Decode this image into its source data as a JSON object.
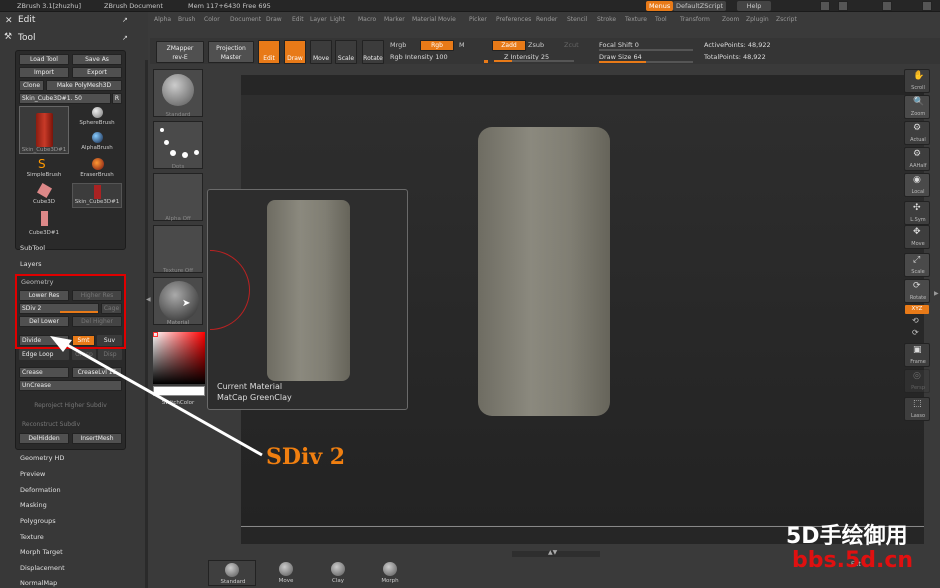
{
  "titlebar": {
    "app": "ZBrush 3.1[zhuzhu]",
    "doc": "ZBrush Document",
    "mem": "Mem 117+6430 Free 695",
    "menus": "Menus",
    "script": "DefaultZScript",
    "help": "Help"
  },
  "menubar": [
    "Alpha",
    "Brush",
    "Color",
    "Document",
    "Draw",
    "Edit",
    "Layer",
    "Light",
    "Macro",
    "Marker",
    "Material",
    "Movie",
    "Picker",
    "Preferences",
    "Render",
    "Stencil",
    "Stroke",
    "Texture",
    "Tool",
    "Transform",
    "Zoom",
    "Zplugin",
    "Zscript"
  ],
  "left": {
    "edit": "Edit",
    "tool": "Tool",
    "load_tool": "Load Tool",
    "save_as": "Save As",
    "import": "Import",
    "export": "Export",
    "clone": "Clone",
    "make_polymesh": "Make PolyMesh3D",
    "tool_name": "Skin_Cube3D#1. 50",
    "r": "R",
    "thumbs": [
      "Skin_Cube3D#1",
      "SphereBrush",
      "AlphaBrush",
      "SimpleBrush",
      "EraserBrush",
      "Cube3D",
      "Skin_Cube3D#1",
      "Cube3D#1"
    ],
    "subtool": "SubTool",
    "layers": "Layers",
    "geometry": "Geometry",
    "lower_res": "Lower Res",
    "higher_res": "Higher Res",
    "sdiv": "SDiv 2",
    "cage": "Cage",
    "del_lower": "Del Lower",
    "del_higher": "Del Higher",
    "divide": "Divide",
    "smt": "Smt",
    "suv": "Suv",
    "edge_loop": "Edge Loop",
    "grasp": "Grasp",
    "disp": "Disp",
    "crease": "Crease",
    "crease_lvl": "CreaseLvl 15",
    "uncrease": "UnCrease",
    "reproject": "Reproject Higher Subdiv",
    "reconstruct": "Reconstruct Subdiv",
    "delhidden": "DelHidden",
    "insertmesh": "InsertMesh",
    "cats": [
      "Geometry HD",
      "Preview",
      "Deformation",
      "Masking",
      "Polygroups",
      "Texture",
      "Morph Target",
      "Displacement",
      "NormalMap"
    ]
  },
  "top": {
    "zmapper": "ZMapper",
    "rev": "rev-E",
    "projection": "Projection",
    "master": "Master",
    "edit": "Edit",
    "draw": "Draw",
    "move": "Move",
    "scale": "Scale",
    "rotate": "Rotate",
    "mrgb": "Mrgb",
    "rgb": "Rgb",
    "m": "M",
    "rgb_int": "Rgb Intensity 100",
    "zadd": "Zadd",
    "zsub": "Zsub",
    "zcut": "Zcut",
    "z_int": "Z Intensity 25",
    "focal": "Focal Shift 0",
    "draw_size": "Draw Size 64",
    "active": "ActivePoints: 48,922",
    "total": "TotalPoints: 48,922"
  },
  "shelf": [
    "Standard",
    "Dots",
    "Alpha Off",
    "Texture Off",
    "Material"
  ],
  "switch": "SwitchColor",
  "right": [
    "Scroll",
    "Zoom",
    "Actual",
    "AAHalf",
    "Local",
    "L.Sym",
    "Move",
    "Scale",
    "Rotate",
    "Frame",
    "Persp",
    "Lasso"
  ],
  "xyz": "XYZ",
  "popup": {
    "l1": "Current Material",
    "l2": "MatCap GreenClay"
  },
  "annotation": "SDiv 2",
  "bottom": [
    "Standard",
    "Move",
    "Clay",
    "Morph"
  ],
  "watermark": {
    "l1": "5D手绘御用",
    "l2": "bbs.5d.cn",
    "ext": "Ext"
  },
  "colors": {
    "accent": "#e87a18",
    "red": "#e00000"
  }
}
